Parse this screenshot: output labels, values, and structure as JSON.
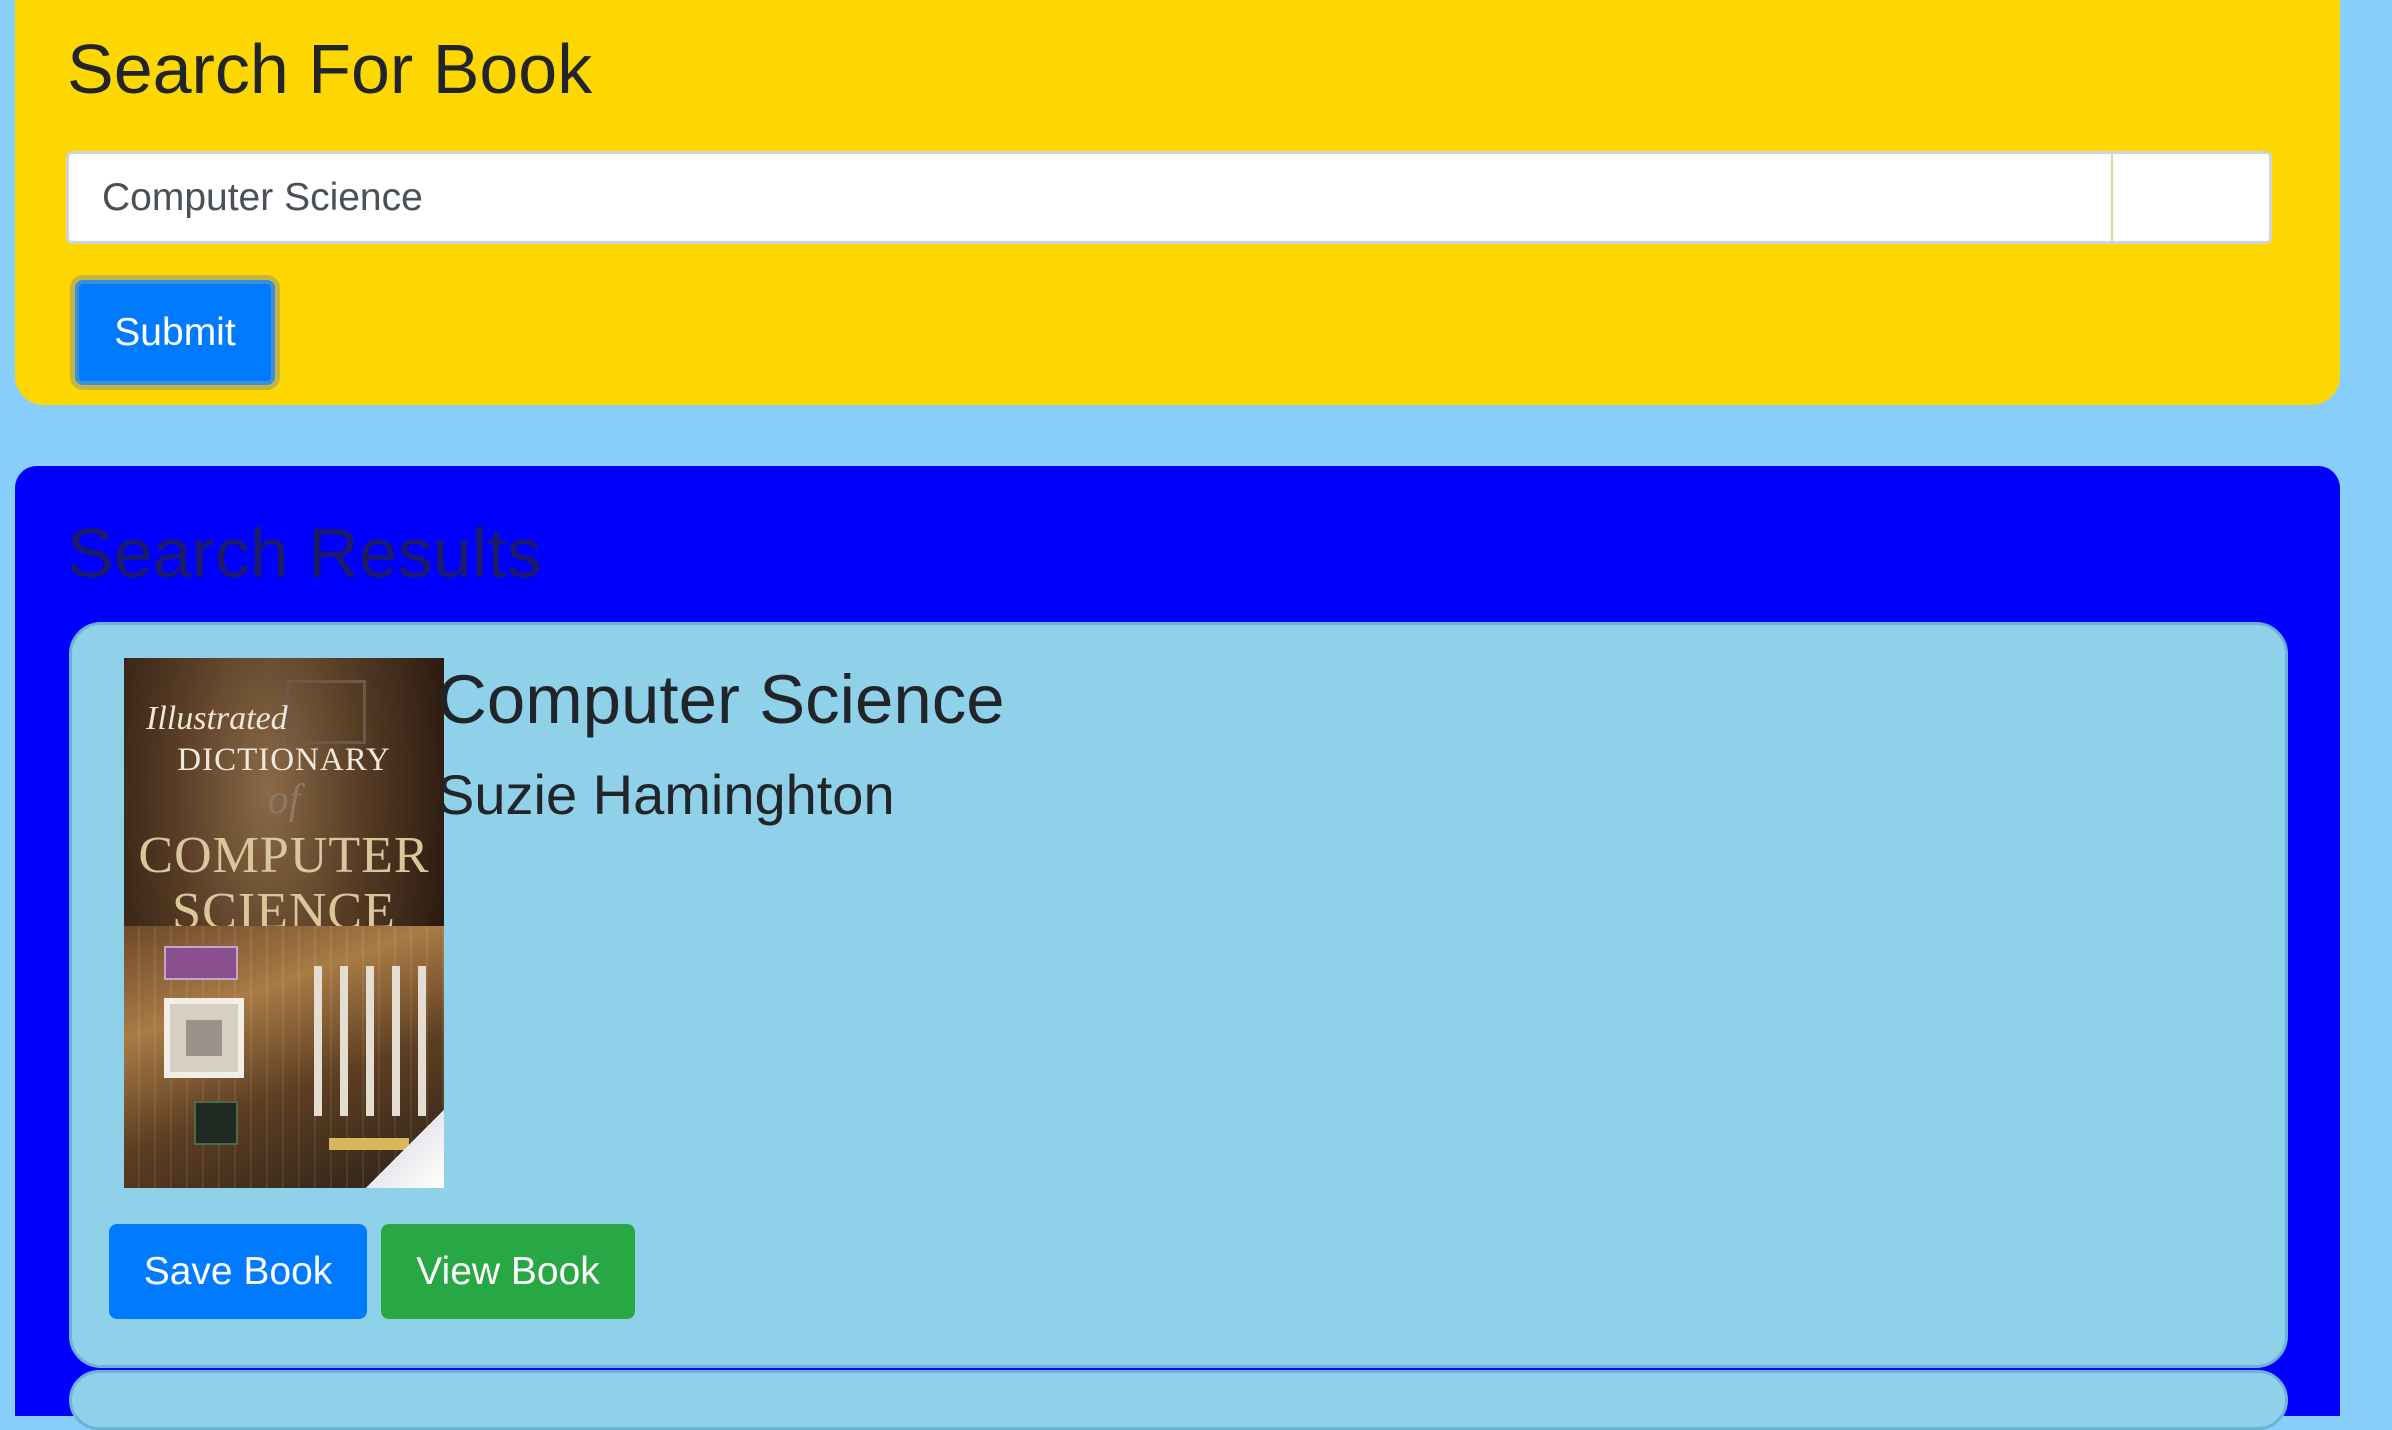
{
  "search": {
    "title": "Search For Book",
    "input_value": "Computer Science",
    "submit_label": "Submit"
  },
  "results": {
    "title": "Search Results",
    "items": [
      {
        "title": "Computer Science",
        "author": "Suzie Haminghton",
        "cover": {
          "line1": "Illustrated",
          "line2": "DICTIONARY",
          "line3": "of",
          "line4": "COMPUTER",
          "line5": "SCIENCE"
        },
        "save_label": "Save Book",
        "view_label": "View Book"
      }
    ]
  },
  "colors": {
    "page_background": "#87cefa",
    "search_panel": "#ffd700",
    "results_panel": "#0000ff",
    "card": "#90d1ea",
    "primary_button": "#007bff",
    "success_button": "#28a745"
  }
}
